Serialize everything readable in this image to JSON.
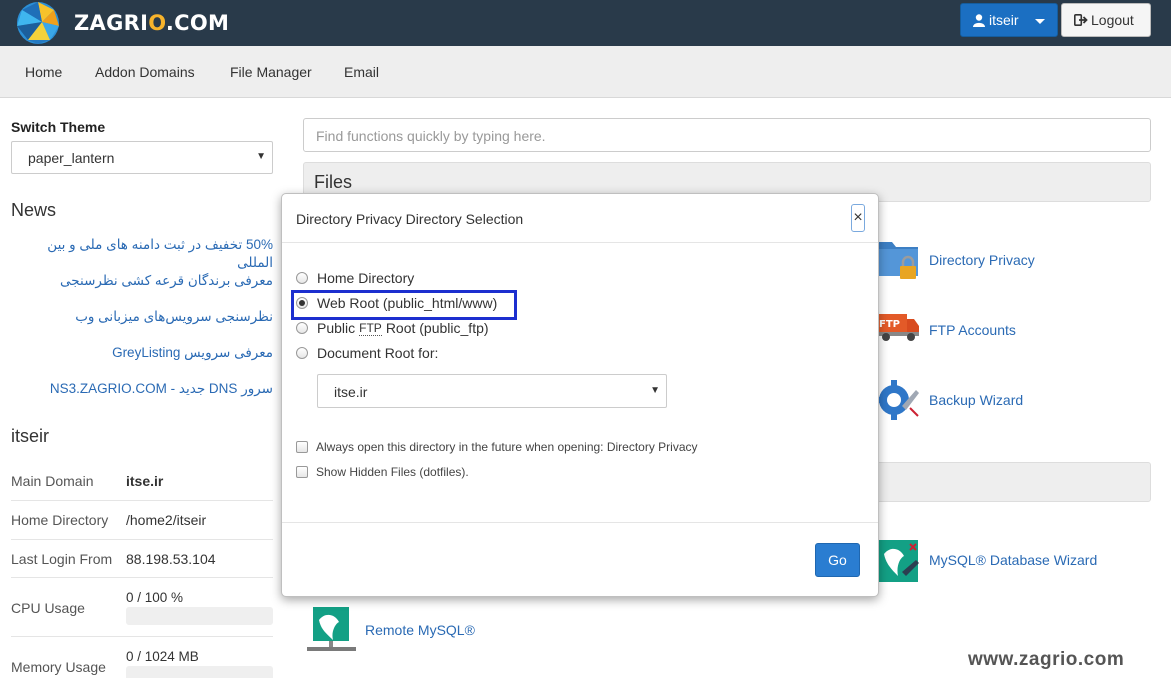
{
  "brand": {
    "logo_text_before": "ZAGRI",
    "logo_text_o": "O",
    "logo_text_after": ".COM"
  },
  "header": {
    "user_label": "itseir",
    "logout_label": "Logout"
  },
  "nav": [
    "Home",
    "Addon Domains",
    "File Manager",
    "Email"
  ],
  "sidebar": {
    "switch_theme_label": "Switch Theme",
    "theme_value": "paper_lantern",
    "news_heading": "News",
    "news": [
      "50% تخفیف در ثبت دامنه های ملی و بین المللی",
      "معرفی برندگان قرعه کشی نظرسنجی",
      "نظرسنجی سرویس‌های میزبانی وب",
      "معرفی سرویس GreyListing",
      "سرور DNS جدید - NS3.ZAGRIO.COM"
    ],
    "user_heading": "itseir",
    "stats": [
      {
        "label": "Main Domain",
        "value": "itse.ir"
      },
      {
        "label": "Home Directory",
        "value": "/home2/itseir"
      },
      {
        "label": "Last Login From",
        "value": "88.198.53.104"
      },
      {
        "label": "CPU Usage",
        "value": "0 / 100 %"
      },
      {
        "label": "Memory Usage",
        "value": "0 / 1024 MB"
      }
    ]
  },
  "main": {
    "search_placeholder": "Find functions quickly by typing here.",
    "files_heading": "Files",
    "features": [
      "Directory Privacy",
      "FTP Accounts",
      "Backup Wizard",
      "MySQL® Database Wizard",
      "Remote MySQL®"
    ]
  },
  "modal": {
    "title": "Directory Privacy  Directory Selection",
    "close": "×",
    "options": [
      "Home Directory",
      "Web Root (public_html/www)",
      "Public",
      "FTP",
      "Root (public_ftp)",
      "Document Root for:"
    ],
    "selected_option": "Web Root (public_html/www)",
    "doc_root_value": "itse.ir",
    "checkboxes": [
      "Always open this directory in the future when opening: Directory Privacy",
      "Show Hidden Files (dotfiles)."
    ],
    "go_label": "Go"
  },
  "watermark": "www.zagrio.com",
  "colors": {
    "topbar": "#293a4a",
    "primary": "#2a7dd1",
    "link": "#2a6ab4",
    "highlight": "#1c2fcf",
    "logo_accent": "#f7b32b"
  }
}
